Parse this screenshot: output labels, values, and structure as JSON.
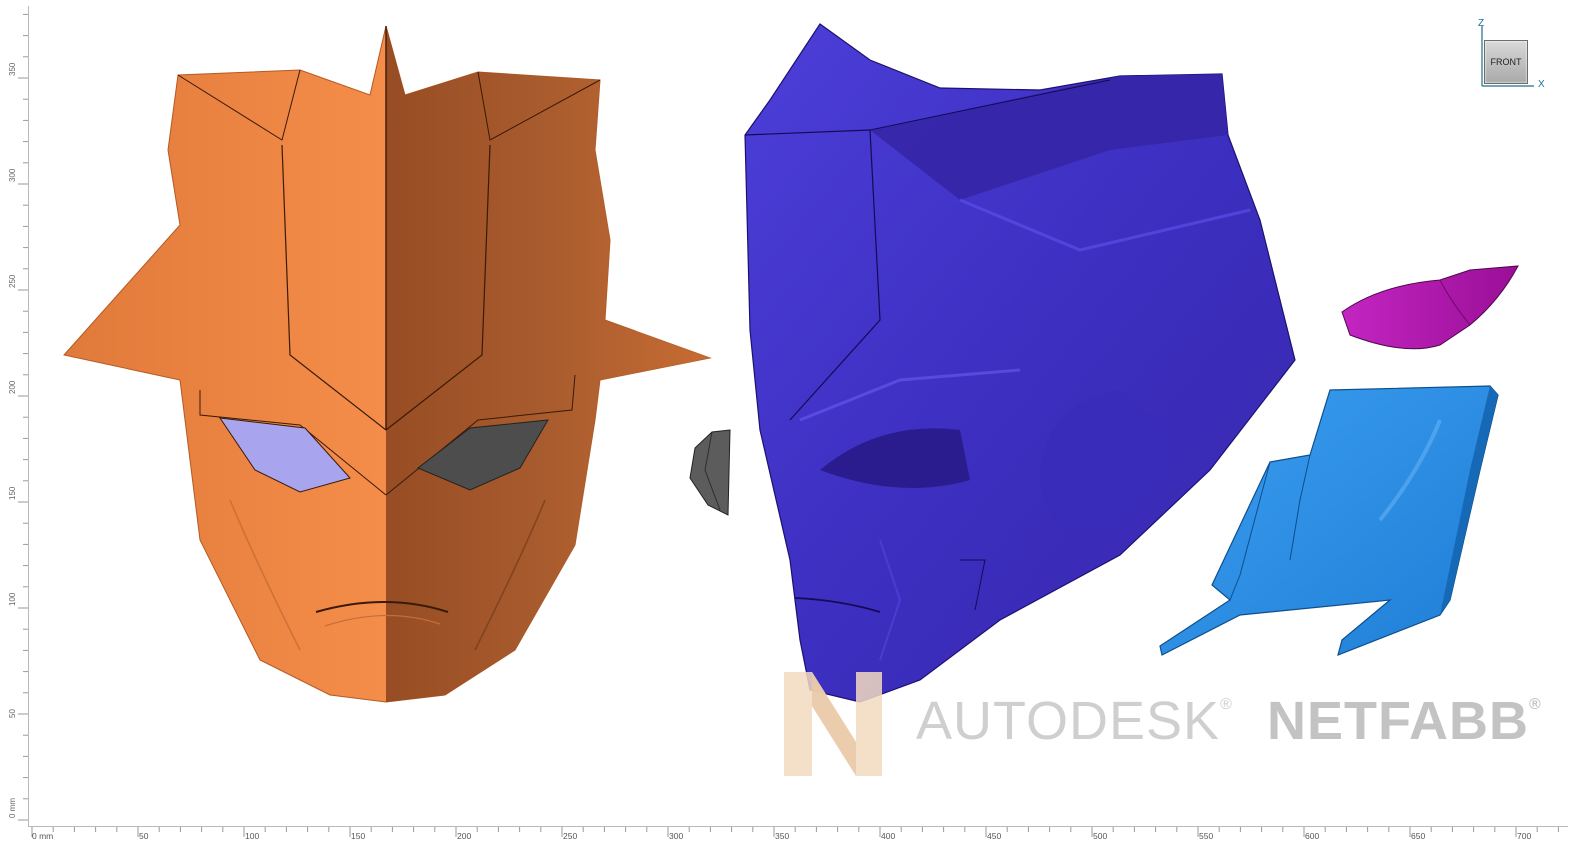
{
  "app": {
    "name": "Autodesk Netfabb"
  },
  "view": {
    "orientation": "FRONT",
    "axes": {
      "vertical": "Z",
      "horizontal": "X"
    }
  },
  "watermark": {
    "brand": "AUTODESK",
    "product": "NETFABB",
    "registered_mark": "®"
  },
  "ruler_vertical": {
    "labels": [
      "0 mm",
      "50",
      "100",
      "150",
      "200",
      "250",
      "300",
      "350"
    ]
  },
  "ruler_horizontal": {
    "labels": [
      "0 mm",
      "50",
      "100",
      "150",
      "200",
      "250",
      "300",
      "350",
      "400",
      "450",
      "500",
      "550",
      "600",
      "650",
      "700"
    ]
  },
  "parts": [
    {
      "name": "front-face-mask",
      "color": "#e8813f"
    },
    {
      "name": "helmet-shell",
      "color": "#4535c8"
    },
    {
      "name": "eye-lens-piece",
      "color": "#555555"
    },
    {
      "name": "crest-fin",
      "color": "#b519b3"
    },
    {
      "name": "side-panel",
      "color": "#2c8fe6"
    }
  ]
}
